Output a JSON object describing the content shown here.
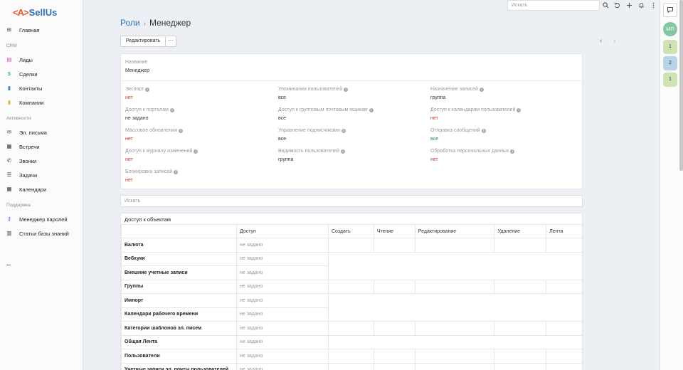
{
  "app": {
    "logo_text": "SellUs",
    "logo_mark": "<A>",
    "brand_color": "#2c74b6",
    "accent_color": "#e4572e"
  },
  "sidebar": {
    "main_item": {
      "label": "Главная",
      "icon": "home-grid-icon"
    },
    "sections": [
      {
        "title": "CRM",
        "items": [
          {
            "label": "Лиды",
            "icon": "leads-card-icon",
            "color": "#c74fa2"
          },
          {
            "label": "Сделки",
            "icon": "dollar-icon",
            "color": "#3aa55d"
          },
          {
            "label": "Контакты",
            "icon": "contact-book-icon",
            "color": "#3b7fd1"
          },
          {
            "label": "Компании",
            "icon": "building-icon",
            "color": "#e1b53a"
          }
        ]
      },
      {
        "title": "Активности",
        "items": [
          {
            "label": "Эл. письма",
            "icon": "envelope-icon",
            "color": "#333333"
          },
          {
            "label": "Встречи",
            "icon": "calendar-check-icon",
            "color": "#333333"
          },
          {
            "label": "Звонки",
            "icon": "phone-icon",
            "color": "#333333"
          },
          {
            "label": "Задачи",
            "icon": "tasks-list-icon",
            "color": "#333333"
          },
          {
            "label": "Календари",
            "icon": "calendar-icon",
            "color": "#333333"
          }
        ]
      },
      {
        "title": "Поддержка",
        "items": [
          {
            "label": "Менеджер паролей",
            "icon": "key-icon",
            "color": "#7a4fc7"
          },
          {
            "label": "Статьи базы знаний",
            "icon": "book-icon",
            "color": "#333333"
          }
        ]
      }
    ],
    "more_label": "..."
  },
  "topbar": {
    "search_placeholder": "Искать"
  },
  "right_panel": {
    "avatar_initials": "МП",
    "badges": [
      {
        "value": "1",
        "color": "#cfe2b4"
      },
      {
        "value": "2",
        "color": "#b7d4e6"
      },
      {
        "value": "1",
        "color": "#cfe2b4"
      }
    ]
  },
  "header": {
    "breadcrumb_parent": "Роли",
    "breadcrumb_current": "Менеджер",
    "edit_button": "Редактировать",
    "more_button": "···",
    "prev_icon": "‹",
    "next_icon": "›"
  },
  "detail": {
    "name_label": "Название",
    "name_value": "Менеджер",
    "fields": [
      {
        "label": "Экспорт",
        "value": "нет",
        "tone": "red"
      },
      {
        "label": "Упоминания пользователей",
        "value": "все",
        "tone": "dark"
      },
      {
        "label": "Назначение записей",
        "value": "группа",
        "tone": "dark"
      },
      {
        "label": "Доступ к порталам",
        "value": "не задано",
        "tone": "dark"
      },
      {
        "label": "Доступ к групповым почтовым ящикам",
        "value": "все",
        "tone": "dark"
      },
      {
        "label": "Доступ к календарям пользователей",
        "value": "нет",
        "tone": "red"
      },
      {
        "label": "Массовое обновления",
        "value": "нет",
        "tone": "red"
      },
      {
        "label": "Управление подписчиками",
        "value": "все",
        "tone": "dark"
      },
      {
        "label": "Отправка сообщений",
        "value": "все",
        "tone": "green"
      },
      {
        "label": "Доступ к журналу изменений",
        "value": "нет",
        "tone": "red"
      },
      {
        "label": "Видимость пользователей",
        "value": "группа",
        "tone": "dark"
      },
      {
        "label": "Обработка персональных данных",
        "value": "нет",
        "tone": "red"
      },
      {
        "label": "Блокировка записей",
        "value": "нет",
        "tone": "red"
      }
    ]
  },
  "search": {
    "placeholder": "Искать"
  },
  "access_table": {
    "title": "Доступ к объектам",
    "columns": [
      "",
      "Доступ",
      "Создать",
      "Чтение",
      "Редактирование",
      "Удаление",
      "Лента"
    ],
    "rows": [
      {
        "name": "Валюта",
        "access": "не задано",
        "full": true
      },
      {
        "name": "Вебхуки",
        "access": "не задано",
        "full": false
      },
      {
        "name": "Внешние учетные записи",
        "access": "не задано",
        "full": false
      },
      {
        "name": "Группы",
        "access": "не задано",
        "full": true
      },
      {
        "name": "Импорт",
        "access": "не задано",
        "full": false
      },
      {
        "name": "Календари рабочего времени",
        "access": "не задано",
        "full": false
      },
      {
        "name": "Категории шаблонов эл. писем",
        "access": "не задано",
        "full": true
      },
      {
        "name": "Общая Лента",
        "access": "не задано",
        "full": false
      },
      {
        "name": "Пользователи",
        "access": "не задано",
        "full": true
      },
      {
        "name": "Учетные записи эл. почты пользователей",
        "access": "не задано",
        "full": true
      }
    ]
  }
}
